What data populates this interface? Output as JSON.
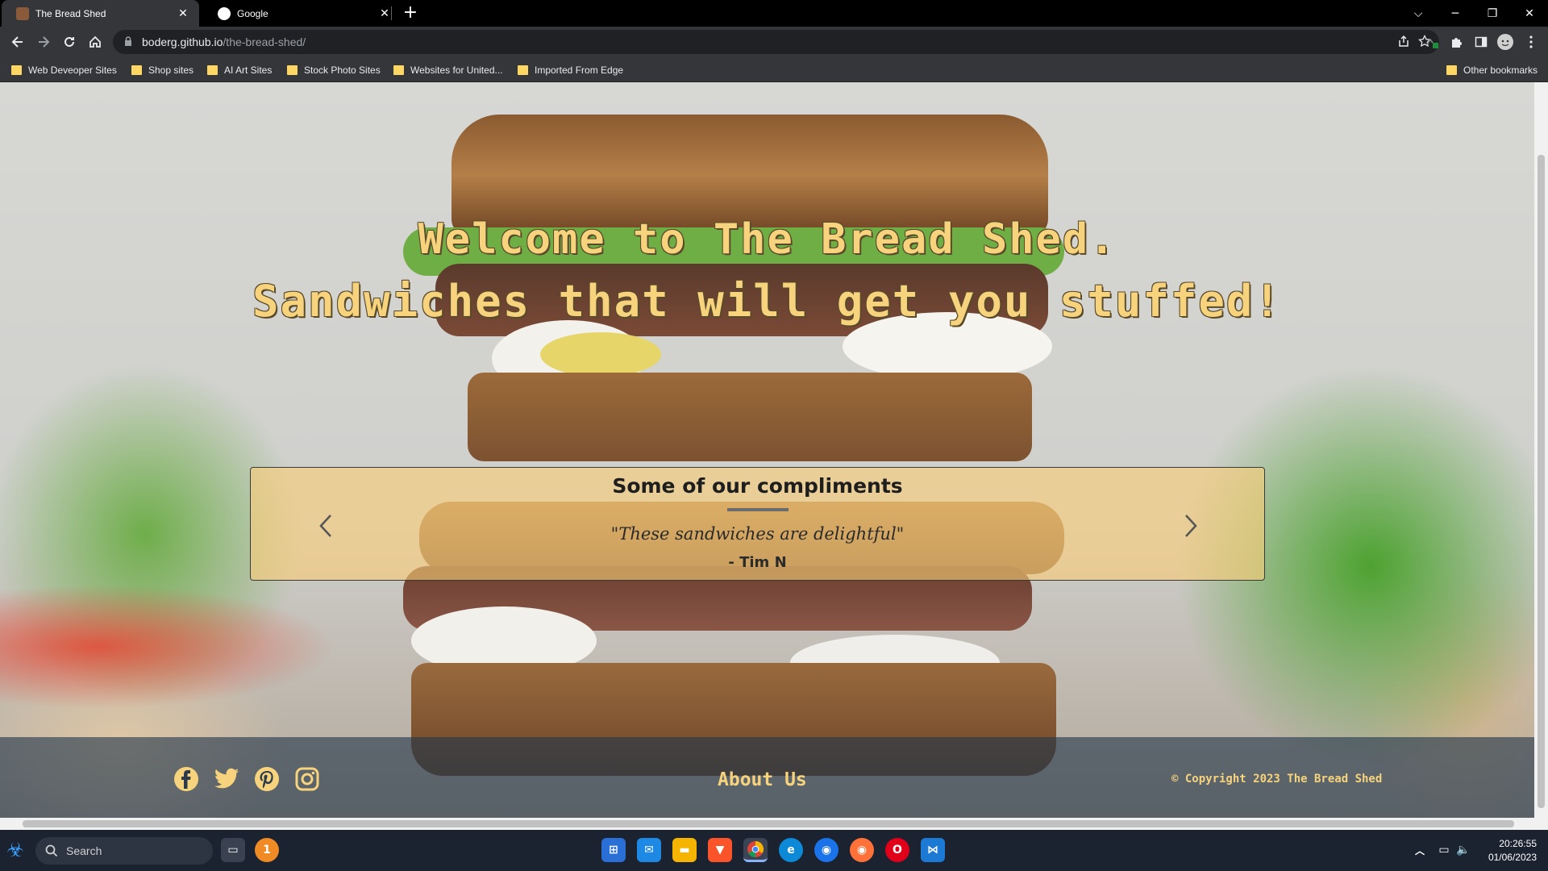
{
  "browser": {
    "tabs": [
      {
        "title": "The Bread Shed",
        "active": true
      },
      {
        "title": "Google",
        "active": false
      }
    ],
    "url_host": "boderg.github.io",
    "url_path": "/the-bread-shed/",
    "bookmarks": [
      "Web Deveoper Sites",
      "Shop sites",
      "AI Art Sites",
      "Stock Photo Sites",
      "Websites for United...",
      "Imported From Edge"
    ],
    "other_bookmarks": "Other bookmarks"
  },
  "page": {
    "headline_line1": "Welcome to The Bread Shed.",
    "headline_line2": "Sandwiches that will get you stuffed!",
    "compliments": {
      "title": "Some of our compliments",
      "quote": "\"These sandwiches are delightful\"",
      "author": "- Tim N"
    },
    "footer": {
      "social": [
        "facebook-icon",
        "twitter-icon",
        "pinterest-icon",
        "instagram-icon"
      ],
      "about": "About Us",
      "copyright": "© Copyright 2023 The Bread Shed"
    }
  },
  "taskbar": {
    "search_label": "Search",
    "time": "20:26:55",
    "date": "01/06/2023",
    "notification_count": "1"
  },
  "colors": {
    "accent_text": "#f6d37c",
    "compliment_box": "#facd78",
    "footer_bg": "#23374b"
  }
}
